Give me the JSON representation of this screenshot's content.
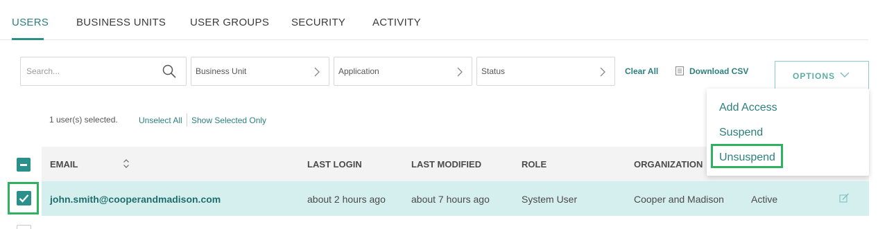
{
  "tabs": [
    {
      "label": "USERS",
      "active": true
    },
    {
      "label": "BUSINESS UNITS",
      "active": false
    },
    {
      "label": "USER GROUPS",
      "active": false
    },
    {
      "label": "SECURITY",
      "active": false
    },
    {
      "label": "ACTIVITY",
      "active": false
    }
  ],
  "filters": {
    "search_placeholder": "Search...",
    "business_unit": "Business Unit",
    "application": "Application",
    "status": "Status",
    "clear_all": "Clear All",
    "download_csv": "Download CSV",
    "options": "OPTIONS"
  },
  "selection": {
    "count_text": "1 user(s) selected.",
    "unselect_all": "Unselect All",
    "show_selected_only": "Show Selected Only"
  },
  "table": {
    "columns": [
      "EMAIL",
      "LAST LOGIN",
      "LAST MODIFIED",
      "ROLE",
      "ORGANIZATION"
    ],
    "rows": [
      {
        "email": "john.smith@cooperandmadison.com",
        "last_login": "about 2 hours ago",
        "last_modified": "about 7 hours ago",
        "role": "System User",
        "organization": "Cooper and Madison",
        "status": "Active",
        "selected": true
      }
    ]
  },
  "options_menu": {
    "items": [
      "Add Access",
      "Suspend",
      "Unsuspend"
    ],
    "highlighted": "Unsuspend"
  },
  "colors": {
    "accent": "#2b8f8b",
    "accent_text": "#2b7f7c",
    "selected_row": "#d4efee",
    "highlight_box": "#2fb25f"
  }
}
